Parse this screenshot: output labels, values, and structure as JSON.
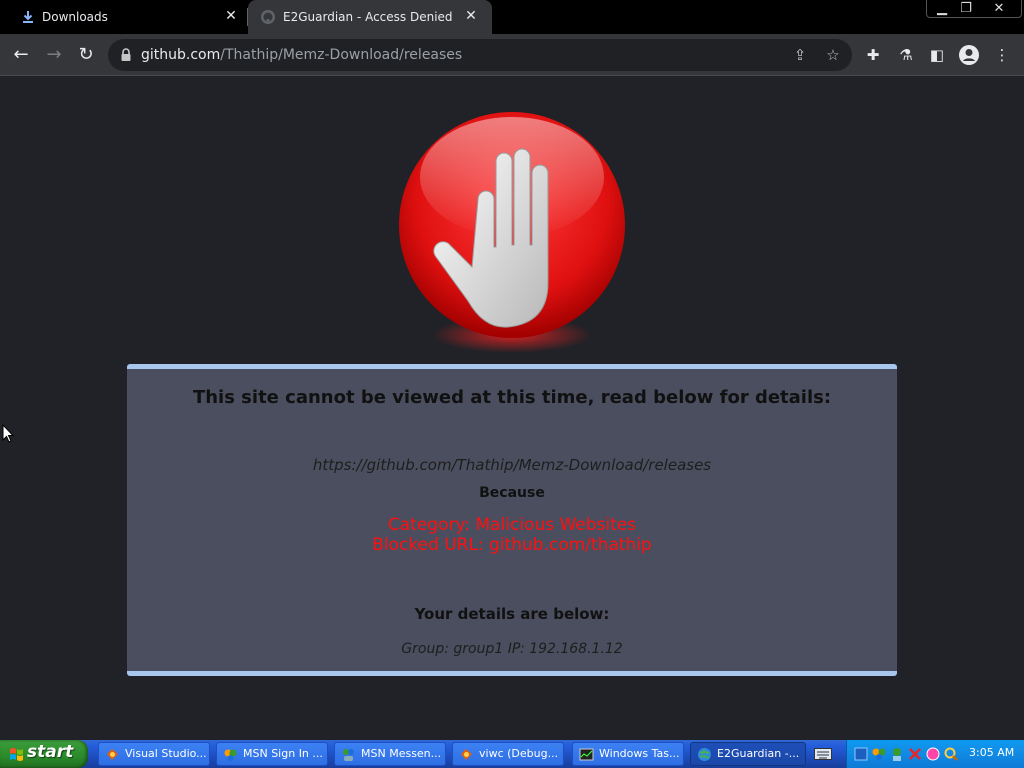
{
  "browser": {
    "tabs": [
      {
        "title": "Downloads",
        "icon": "download-icon",
        "active": false
      },
      {
        "title": "E2Guardian - Access Denied",
        "icon": "github-icon",
        "active": true
      }
    ],
    "address": {
      "host": "github.com",
      "path": "/Thathip/Memz-Download/releases"
    }
  },
  "page": {
    "heading": "This site cannot be viewed at this time, read below for details:",
    "blocked_url": "https://github.com/Thathip/Memz-Download/releases",
    "because_label": "Because",
    "category_line": "Category: Malicious Websites",
    "blocked_url_line": "Blocked URL: github.com/thathip",
    "details_heading": "Your details are below:",
    "details_line": "Group: group1   IP: 192.168.1.12"
  },
  "taskbar": {
    "start_label": "start",
    "tasks": [
      {
        "label": "Visual Studio...",
        "active": false
      },
      {
        "label": "MSN Sign In ...",
        "active": false
      },
      {
        "label": "MSN Messen...",
        "active": false
      },
      {
        "label": "viwc (Debug...",
        "active": false
      },
      {
        "label": "Windows Tas...",
        "active": false
      },
      {
        "label": "E2Guardian -...",
        "active": true
      }
    ],
    "clock": "3:05 AM"
  },
  "colors": {
    "panel_bg": "#4a4e5e",
    "panel_border": "#a7c7ee",
    "reason_red": "#ff1010",
    "page_bg": "#202227"
  }
}
